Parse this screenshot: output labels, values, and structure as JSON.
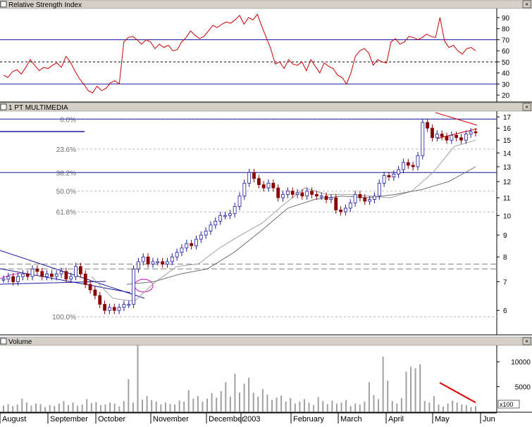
{
  "panels": {
    "rsi": {
      "title": "Relative Strength Index",
      "ticks": [
        "90",
        "80",
        "70",
        "60",
        "50",
        "40",
        "30",
        "20"
      ]
    },
    "price": {
      "title": "1 PT MULTIMEDIA",
      "ticks": [
        "17",
        "16",
        "15",
        "14",
        "13",
        "12",
        "11",
        "10",
        "9",
        "8",
        "7",
        "6"
      ]
    },
    "volume": {
      "title": "Volume",
      "ticks": [
        "10000",
        "5000"
      ],
      "multiplier": "x100"
    }
  },
  "months": [
    "August",
    "September",
    "October",
    "November",
    "December",
    "2003",
    "February",
    "March",
    "April",
    "May",
    "Jun"
  ],
  "fib_labels": [
    "0.0%",
    "23.6%",
    "38.2%",
    "50.0%",
    "61.8%",
    "100.0%"
  ],
  "colors": {
    "rsi_line": "#cc0000",
    "up_candle": "#1a1aa0",
    "down_candle": "#8b0000",
    "trend_line": "#1a1aa0",
    "triangle": "#cc0000",
    "volume_bar": "#a0a0a0",
    "volume_trend": "#dd0000",
    "circle": "#cc33cc"
  },
  "chart_data": [
    {
      "type": "line",
      "title": "Relative Strength Index",
      "ylim": [
        15,
        97
      ],
      "yticks": [
        90,
        80,
        70,
        60,
        50,
        40,
        30,
        20
      ],
      "reference_lines": [
        70,
        50,
        30
      ],
      "series": [
        {
          "values": [
            38,
            36,
            41,
            43,
            39,
            45,
            52,
            47,
            42,
            45,
            44,
            47,
            49,
            45,
            55,
            50,
            42,
            35,
            30,
            24,
            22,
            28,
            24,
            26,
            31,
            33,
            30,
            68,
            72,
            73,
            70,
            66,
            70,
            68,
            62,
            66,
            63,
            65,
            60,
            61,
            68,
            72,
            78,
            74,
            71,
            73,
            78,
            83,
            81,
            84,
            86,
            85,
            88,
            92,
            84,
            90,
            88,
            93,
            82,
            72,
            62,
            48,
            50,
            44,
            52,
            48,
            47,
            50,
            42,
            52,
            46,
            40,
            49,
            46,
            44,
            38,
            36,
            30,
            40,
            55,
            60,
            62,
            58,
            47,
            52,
            50,
            49,
            68,
            71,
            66,
            68,
            73,
            72,
            70,
            72,
            75,
            73,
            72,
            90,
            69,
            63,
            65,
            60,
            57,
            62,
            63,
            60
          ]
        }
      ]
    },
    {
      "type": "candlestick",
      "title": "1 PT MULTIMEDIA",
      "ylim": [
        5.3,
        17.4
      ],
      "yticks": [
        17,
        16,
        15,
        14,
        13,
        12,
        11,
        10,
        9,
        8,
        7,
        6
      ],
      "y_scale": "log",
      "x_axis_months": [
        "August",
        "September",
        "October",
        "November",
        "December",
        "2003",
        "February",
        "March",
        "April",
        "May",
        "Jun"
      ],
      "fibonacci_levels": [
        {
          "label": "0.0%",
          "value": 16.8
        },
        {
          "label": "23.6%",
          "value": 14.3
        },
        {
          "label": "38.2%",
          "value": 12.6
        },
        {
          "label": "50.0%",
          "value": 11.4
        },
        {
          "label": "61.8%",
          "value": 10.2
        },
        {
          "label": "100.0%",
          "value": 5.8
        }
      ],
      "horizontal_lines": [
        16.8,
        12.6
      ],
      "dashed_levels": [
        7.7,
        7.5
      ],
      "close": [
        7.1,
        7.2,
        7.0,
        7.2,
        7.3,
        7.2,
        7.5,
        7.4,
        7.2,
        7.3,
        7.2,
        7.3,
        7.4,
        7.1,
        7.2,
        7.6,
        7.3,
        6.9,
        6.7,
        6.5,
        6.2,
        6.0,
        6.1,
        6.0,
        6.1,
        6.2,
        6.2,
        7.5,
        7.8,
        8.0,
        7.7,
        7.8,
        7.8,
        7.7,
        7.8,
        8.0,
        8.2,
        8.4,
        8.6,
        8.5,
        8.8,
        9.0,
        9.2,
        9.5,
        9.7,
        10.0,
        10.0,
        10.1,
        10.5,
        11.1,
        11.9,
        12.6,
        12.2,
        11.8,
        11.6,
        11.9,
        11.6,
        11.0,
        11.2,
        11.4,
        11.2,
        11.3,
        11.1,
        11.4,
        11.2,
        11.1,
        11.1,
        10.9,
        11.0,
        10.3,
        10.2,
        10.4,
        10.7,
        11.2,
        11.0,
        10.8,
        10.9,
        11.1,
        11.9,
        12.4,
        12.3,
        12.5,
        12.8,
        13.3,
        13.1,
        13.0,
        13.8,
        16.5,
        16.0,
        15.2,
        15.5,
        15.3,
        15.0,
        15.4,
        15.2,
        15.0,
        15.5,
        15.7,
        15.6
      ],
      "moving_averages": [
        {
          "period": "short",
          "color": "#a0a0a0",
          "values": [
            7.2,
            6.4,
            6.3,
            7.0,
            7.6,
            7.7,
            8.4,
            9.0,
            9.6,
            10.6,
            11.6,
            11.2,
            11.2,
            11.1,
            11.0,
            11.4,
            12.6,
            14.5,
            15.0
          ]
        },
        {
          "period": "long",
          "color": "#707070",
          "values": [
            6.9,
            7.0,
            7.3,
            7.5,
            8.2,
            9.2,
            10.4,
            10.9,
            11.1,
            11.0,
            11.2,
            11.5,
            12.0,
            13.0
          ]
        }
      ]
    },
    {
      "type": "bar",
      "title": "Volume",
      "unit": "x100",
      "ylim": [
        0,
        13000
      ],
      "yticks": [
        10000,
        5000
      ],
      "values": [
        1200,
        1500,
        1100,
        1400,
        2600,
        1800,
        1200,
        1600,
        1500,
        900,
        1300,
        1100,
        1600,
        2100,
        1300,
        1800,
        1200,
        1400,
        2500,
        1700,
        1900,
        1300,
        1400,
        1800,
        1600,
        1000,
        2100,
        6500,
        1800,
        13500,
        2400,
        3100,
        2300,
        2000,
        1400,
        1800,
        1500,
        1400,
        2200,
        2000,
        4300,
        2600,
        3100,
        2000,
        2600,
        3700,
        2800,
        4100,
        5900,
        3000,
        7600,
        3800,
        5600,
        6800,
        3800,
        3000,
        4500,
        3400,
        2300,
        2800,
        3200,
        2000,
        2700,
        1600,
        2000,
        2500,
        1800,
        1300,
        2900,
        2100,
        1500,
        2200,
        1600,
        1800,
        2300,
        1100,
        1600,
        1400,
        2000,
        5900,
        3300,
        2500,
        11000,
        6200,
        2100,
        1600,
        2700,
        8000,
        9000,
        8700,
        9500,
        2100,
        1800,
        3100,
        1400,
        1000,
        1600,
        2200,
        1800,
        1400,
        1300,
        900,
        1100
      ],
      "trend_line": {
        "from": 5800,
        "to": 1800
      }
    }
  ]
}
